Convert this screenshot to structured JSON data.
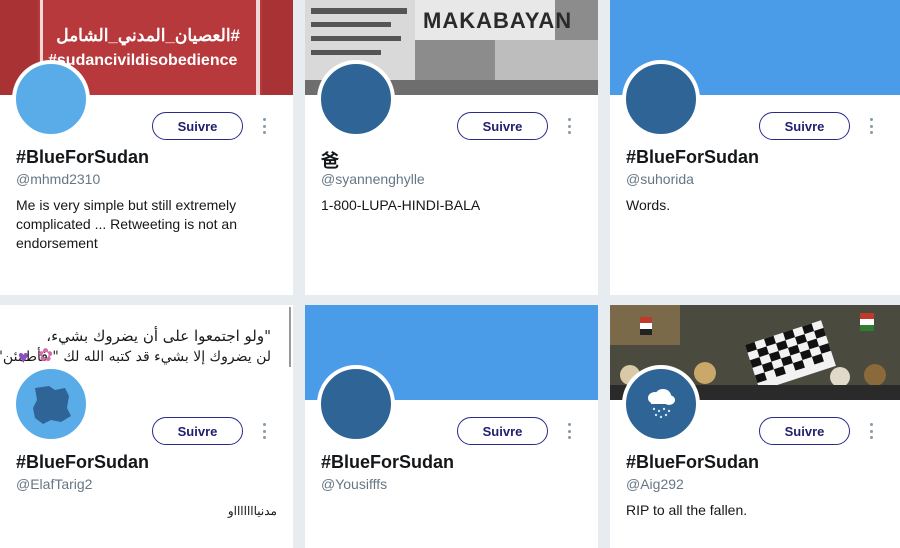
{
  "colors": {
    "page_bg": "#e6ecf0",
    "follow_border": "#2a2a8a",
    "twitter_blue": "#4a9be8",
    "avatar_blue": "#2e6596",
    "avatar_light_blue": "#5aace8",
    "banner_red": "#b8393c"
  },
  "cards": [
    {
      "banner_text_line1": "#العصيان_المدني_الشامل",
      "banner_text_line2": "#sudancivildisobedience",
      "follow_label": "Suivre",
      "name": "#BlueForSudan",
      "handle": "@mhmd2310",
      "bio": "Me is very simple but still extremely complicated ... Retweeting is not an endorsement"
    },
    {
      "banner_text": "MAKABAYAN",
      "follow_label": "Suivre",
      "name": "爸",
      "handle": "@syannenghylle",
      "bio": "1-800-LUPA-HINDI-BALA"
    },
    {
      "follow_label": "Suivre",
      "name": "#BlueForSudan",
      "handle": "@suhorida",
      "bio": "Words."
    },
    {
      "banner_text_line1": "\"ولو اجتمعوا على أن يضروك بشيء،",
      "banner_text_line2": "لن يضروك إلا بشيء قد كتبه الله لك \" فأطمئن\"",
      "follow_label": "Suivre",
      "name": "#BlueForSudan",
      "handle": "@ElafTarig2",
      "bio": "مدنياااااااو"
    },
    {
      "follow_label": "Suivre",
      "name": "#BlueForSudan",
      "handle": "@Yousifffs",
      "bio": ""
    },
    {
      "follow_label": "Suivre",
      "name": "#BlueForSudan",
      "handle": "@Aig292",
      "bio": "RIP to all the fallen."
    }
  ]
}
